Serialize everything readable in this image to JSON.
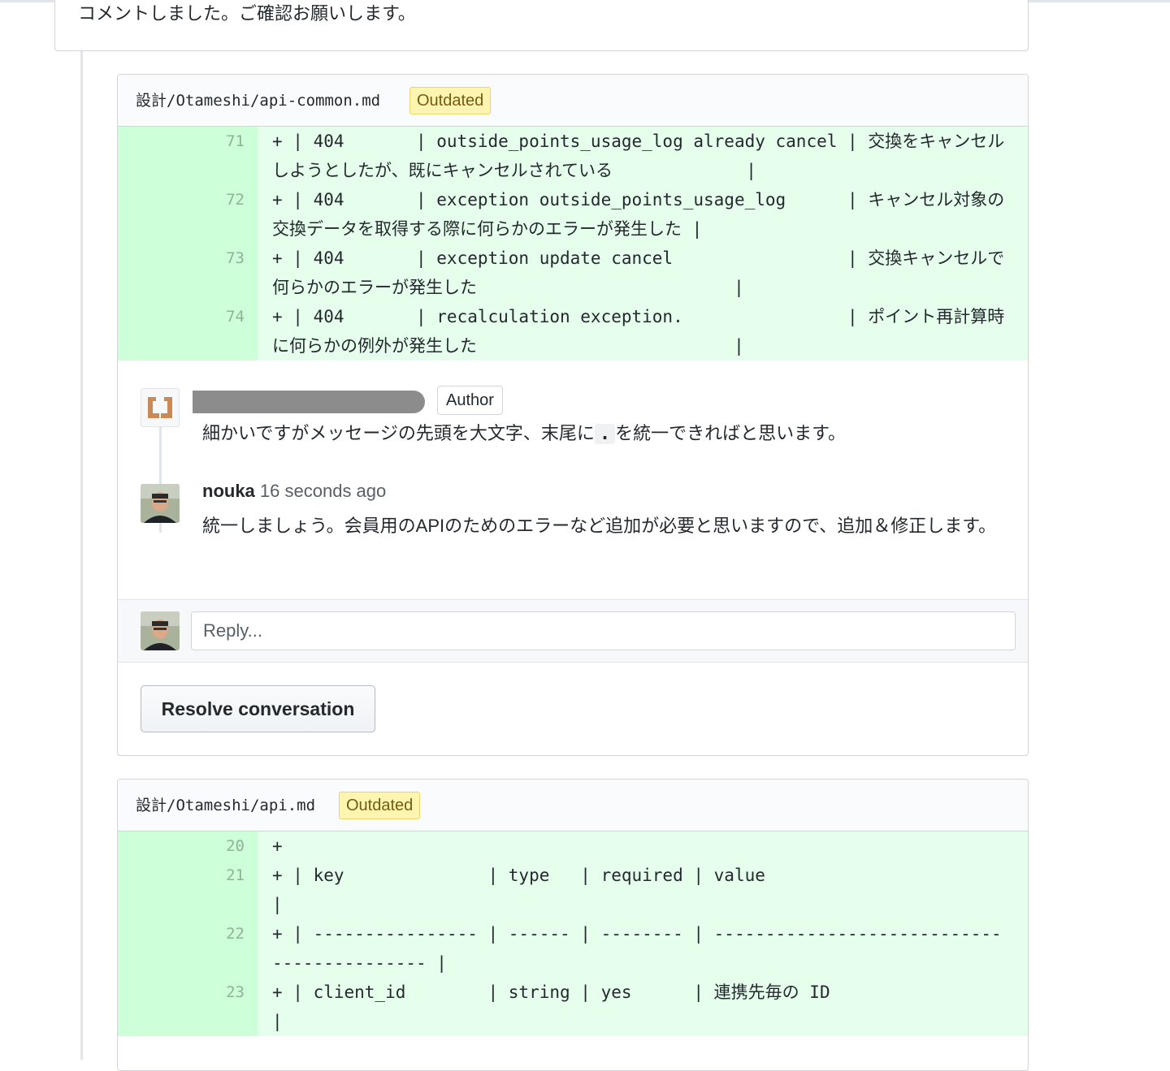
{
  "top_comment": {
    "text": "コメントしました。ご確認お願いします。"
  },
  "reviews": [
    {
      "file_path": "設計/Otameshi/api-common.md",
      "badge": "Outdated",
      "lines": [
        {
          "num": "71",
          "code": "+ | 404       | outside_points_usage_log already cancel | 交換をキャンセルしようとしたが、既にキャンセルされている             |"
        },
        {
          "num": "72",
          "code": "+ | 404       | exception outside_points_usage_log      | キャンセル対象の交換データを取得する際に何らかのエラーが発生した |"
        },
        {
          "num": "73",
          "code": "+ | 404       | exception update cancel                 | 交換キャンセルで何らかのエラーが発生した                         |"
        },
        {
          "num": "74",
          "code": "+ | 404       | recalculation exception.                | ポイント再計算時に何らかの例外が発生した                         |"
        }
      ],
      "thread": {
        "first_comment": {
          "author_badge": "Author",
          "body_before": "細かいですがメッセージの先頭を大文字、末尾に",
          "body_code": ".",
          "body_after": "を統一できればと思います。"
        },
        "second_comment": {
          "author": "nouka",
          "time": "16 seconds ago",
          "body": "統一しましょう。会員用のAPIのためのエラーなど追加が必要と思いますので、追加＆修正します。"
        },
        "reply_placeholder": "Reply...",
        "resolve_label": "Resolve conversation"
      }
    },
    {
      "file_path": "設計/Otameshi/api.md",
      "badge": "Outdated",
      "lines": [
        {
          "num": "20",
          "code": "+"
        },
        {
          "num": "21",
          "code": "+ | key              | type   | required | value                                   |"
        },
        {
          "num": "22",
          "code": "+ | ---------------- | ------ | -------- | ------------------------------------------- |"
        },
        {
          "num": "23",
          "code": "+ | client_id        | string | yes      | 連携先毎の ID                                |"
        }
      ]
    }
  ],
  "colors": {
    "added_line_bg": "#e6ffed",
    "added_gutter_bg": "#cdffd8",
    "outdated_badge_bg": "#fff5b1",
    "border": "#d1d5da"
  },
  "icons": {
    "first_avatar": "bracket-logo-avatar-icon",
    "second_avatar": "user-photo-avatar-icon"
  }
}
